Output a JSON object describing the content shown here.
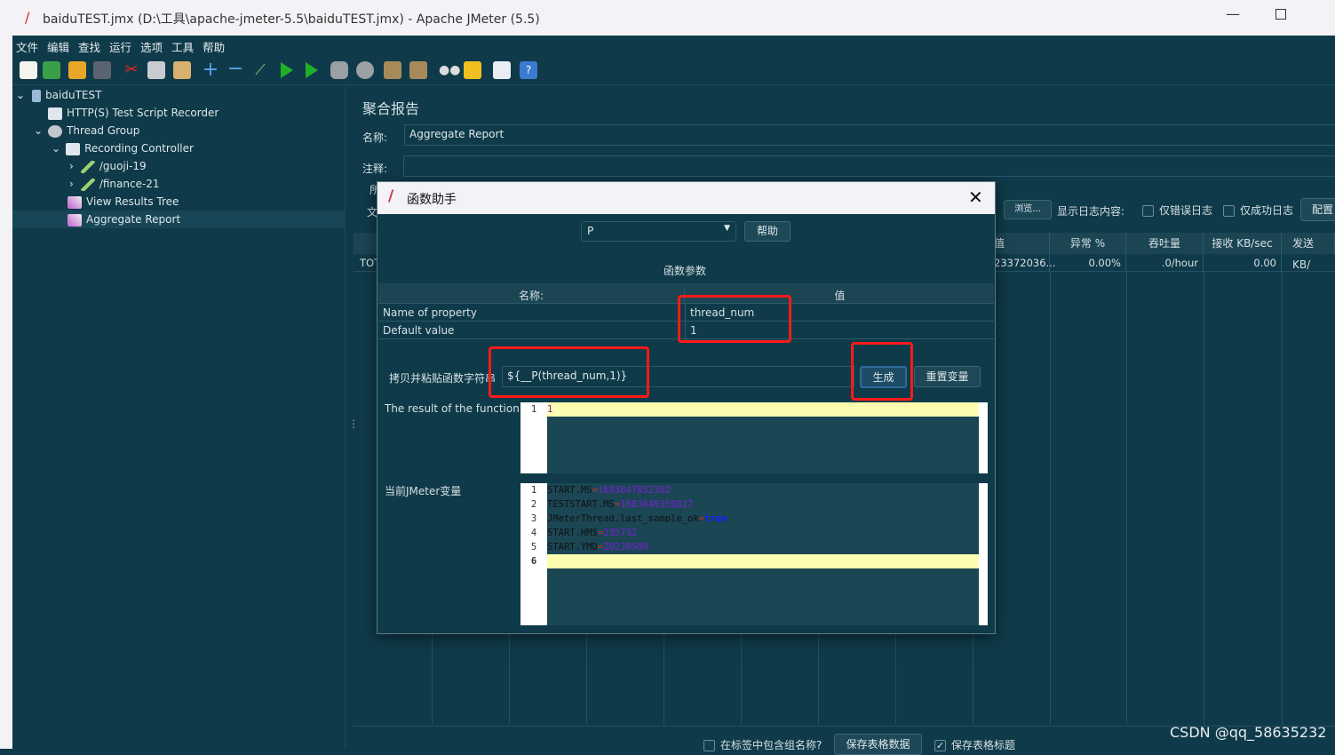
{
  "window": {
    "title": "baiduTEST.jmx (D:\\工具\\apache-jmeter-5.5\\baiduTEST.jmx) - Apache JMeter (5.5)"
  },
  "menu": [
    "文件",
    "编辑",
    "查找",
    "运行",
    "选项",
    "工具",
    "帮助"
  ],
  "toolbar": [
    "new-icon",
    "templates-icon",
    "open-icon",
    "save-icon",
    "cut-icon",
    "copy-icon",
    "paste-icon",
    "expand-icon",
    "collapse-icon",
    "toggle-icon",
    "start-icon",
    "start-no-pause-icon",
    "stop-icon",
    "shutdown-icon",
    "clear-icon",
    "clear-all-icon",
    "search-icon",
    "reset-search-icon",
    "function-helper-icon",
    "help-icon"
  ],
  "tree": [
    {
      "label": "baiduTEST",
      "level": 0,
      "expanded": true
    },
    {
      "label": "HTTP(S) Test Script Recorder",
      "level": 1
    },
    {
      "label": "Thread Group",
      "level": 1,
      "expanded": true
    },
    {
      "label": "Recording Controller",
      "level": 2,
      "expanded": true
    },
    {
      "label": "/guoji-19",
      "level": 3,
      "collapsed": true
    },
    {
      "label": "/finance-21",
      "level": 3,
      "collapsed": true
    },
    {
      "label": "View Results Tree",
      "level": 2
    },
    {
      "label": "Aggregate Report",
      "level": 2,
      "selected": true
    }
  ],
  "panel": {
    "title": "聚合报告",
    "name_label": "名称:",
    "name_value": "Aggregate Report",
    "comment_label": "注释:",
    "partial_left": [
      "所",
      "文"
    ],
    "browse": "浏览...",
    "log_label": "显示日志内容:",
    "errors_only": "仅错误日志",
    "success_only": "仅成功日志",
    "config": "配置",
    "columns": [
      "最大值",
      "异常 %",
      "吞吐量",
      "接收 KB/sec",
      "发送 KB/"
    ],
    "total_row": {
      "label": "TOT",
      "max": "23372036...",
      "error": "0.00%",
      "throughput": ".0/hour",
      "received": "0.00",
      "sent": ""
    },
    "include_group": "在标签中包含组名称?",
    "save_table": "保存表格数据",
    "save_header": "保存表格标题",
    "save_header_checked": true
  },
  "dialog": {
    "title": "函数助手",
    "function_select": "P",
    "help": "帮助",
    "params_title": "函数参数",
    "param_headers": [
      "名称:",
      "值"
    ],
    "params": [
      {
        "name": "Name of property",
        "value": "thread_num"
      },
      {
        "name": "Default value",
        "value": "1"
      }
    ],
    "copy_label": "拷贝并粘贴函数字符串",
    "function_string": "${__P(thread_num,1)}",
    "generate": "生成",
    "reset": "重置变量",
    "result_label": "The result of the function is",
    "result_lines": [
      "1"
    ],
    "vars_label": "当前JMeter变量",
    "vars": [
      {
        "key": "START.MS",
        "value": "1683647852382"
      },
      {
        "key": "TESTSTART.MS",
        "value": "1683649359827"
      },
      {
        "key": "JMeterThread.last_sample_ok",
        "value": "true"
      },
      {
        "key": "START.HMS",
        "value": "235732"
      },
      {
        "key": "START.YMD",
        "value": "20230509"
      },
      {
        "key": "",
        "value": ""
      }
    ]
  },
  "watermark": "CSDN @qq_58635232",
  "colors": {
    "background": "#0f3a49",
    "highlight_box": "#ff1a1a",
    "current_line": "#fdfdb0"
  }
}
